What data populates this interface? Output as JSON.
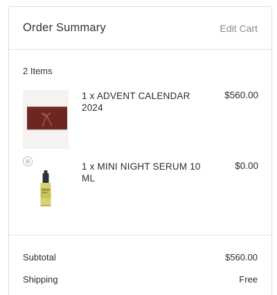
{
  "header": {
    "title": "Order Summary",
    "edit_label": "Edit Cart"
  },
  "items_count": "2 Items",
  "items": [
    {
      "name": "1 x ADVENT CALENDAR 2024",
      "price": "$560.00",
      "image_icon": "gift-box-image"
    },
    {
      "name": "1 x MINI NIGHT SERUM 10 ML",
      "price": "$0.00",
      "image_icon": "serum-bottle-image",
      "badge_icon": "gift-icon"
    }
  ],
  "totals": {
    "subtotal_label": "Subtotal",
    "subtotal_value": "$560.00",
    "shipping_label": "Shipping",
    "shipping_value": "Free"
  },
  "colors": {
    "box": "#6e2621",
    "ribbon": "#9a4a40",
    "serum_liquid": "#d8d36a",
    "serum_cap": "#27343f"
  }
}
